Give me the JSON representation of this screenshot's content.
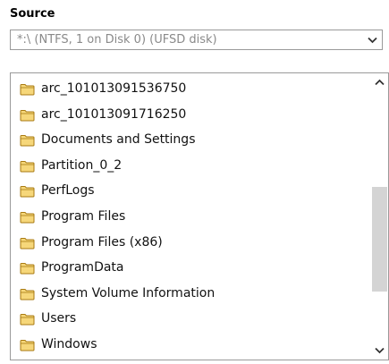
{
  "source_label": "Source",
  "drive": {
    "selected": "*:\\ (NTFS, 1 on Disk 0) (UFSD disk)"
  },
  "folders": [
    {
      "name": "arc_101013091536750"
    },
    {
      "name": "arc_101013091716250"
    },
    {
      "name": "Documents and Settings"
    },
    {
      "name": "Partition_0_2"
    },
    {
      "name": "PerfLogs"
    },
    {
      "name": "Program Files"
    },
    {
      "name": "Program Files (x86)"
    },
    {
      "name": "ProgramData"
    },
    {
      "name": "System Volume Information"
    },
    {
      "name": "Users"
    },
    {
      "name": "Windows"
    }
  ],
  "colors": {
    "folder_fill": "#f6d77a",
    "folder_outline": "#a87a12",
    "scroll_thumb": "#d4d4d4"
  },
  "icons": {
    "folder": "folder-icon",
    "dropdown": "chevron-down-icon",
    "scroll_up": "chevron-up-icon",
    "scroll_down": "chevron-down-icon"
  }
}
